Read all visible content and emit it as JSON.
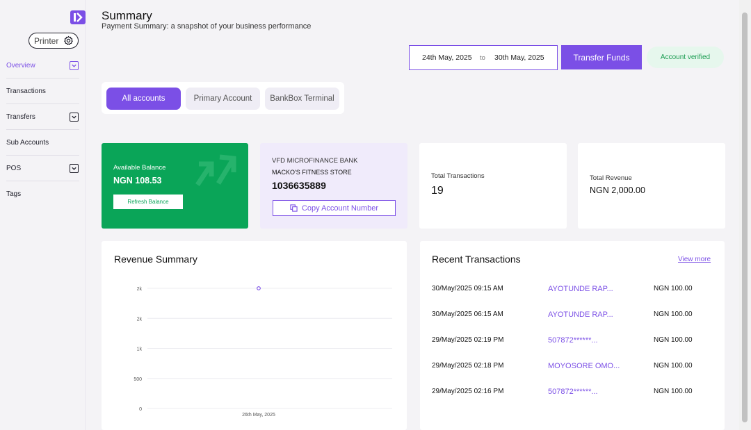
{
  "sidebar": {
    "printer_label": "Printer",
    "items": [
      {
        "label": "Overview",
        "has_chevron": true
      },
      {
        "label": "Transactions",
        "has_chevron": false
      },
      {
        "label": "Transfers",
        "has_chevron": true
      },
      {
        "label": "Sub Accounts",
        "has_chevron": false
      },
      {
        "label": "POS",
        "has_chevron": true
      },
      {
        "label": "Tags",
        "has_chevron": false
      }
    ]
  },
  "header": {
    "title": "Summary",
    "subtitle": "Payment Summary: a snapshot of your business performance"
  },
  "date_range": {
    "start": "24th May, 2025",
    "separator": "to",
    "end": "30th May, 2025"
  },
  "actions": {
    "transfer_label": "Transfer Funds",
    "verified_label": "Account verified"
  },
  "tabs": [
    "All accounts",
    "Primary Account",
    "BankBox Terminal"
  ],
  "balance": {
    "label": "Available Balance",
    "value": "NGN 108.53",
    "refresh_label": "Refresh Balance"
  },
  "bank": {
    "name": "VFD MICROFINANCE BANK",
    "store": "MACKO'S FITNESS STORE",
    "account_number": "1036635889",
    "copy_label": "Copy Account Number"
  },
  "stats": {
    "transactions_label": "Total Transactions",
    "transactions_value": "19",
    "revenue_label": "Total Revenue",
    "revenue_value": "NGN 2,000.00"
  },
  "revenue_summary": {
    "title": "Revenue Summary"
  },
  "chart_data": {
    "type": "line",
    "title": "Revenue Summary",
    "x": [
      "26th May, 2025"
    ],
    "series": [
      {
        "values": [
          2000
        ]
      }
    ],
    "yticks": [
      "0",
      "500",
      "1k",
      "2k",
      "2k"
    ],
    "ylim": [
      0,
      2000
    ],
    "grid": true
  },
  "recent": {
    "title": "Recent Transactions",
    "view_more": "View more",
    "rows": [
      {
        "date": "30/May/2025 09:15 AM",
        "name": "AYOTUNDE RAP...",
        "amount": "NGN 100.00"
      },
      {
        "date": "30/May/2025 06:15 AM",
        "name": "AYOTUNDE RAP...",
        "amount": "NGN 100.00"
      },
      {
        "date": "29/May/2025 02:19 PM",
        "name": "507872******...",
        "amount": "NGN 100.00"
      },
      {
        "date": "29/May/2025 02:18 PM",
        "name": "MOYOSORE OMO...",
        "amount": "NGN 100.00"
      },
      {
        "date": "29/May/2025 02:16 PM",
        "name": "507872******...",
        "amount": "NGN 100.00"
      }
    ]
  },
  "colors": {
    "accent": "#7b4fe6",
    "balance_green": "#0aa558",
    "verified_bg": "#e6f7ed"
  }
}
